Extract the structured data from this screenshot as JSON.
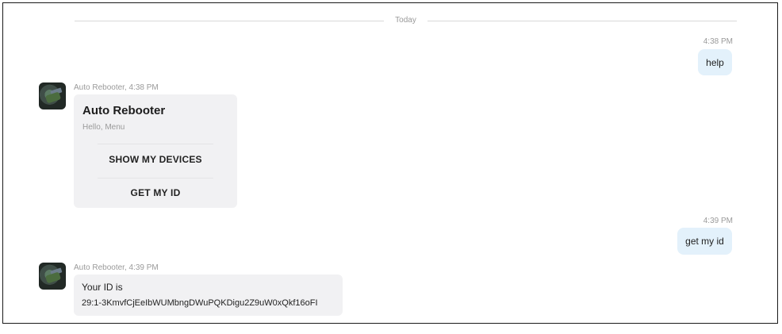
{
  "day_divider": "Today",
  "messages": [
    {
      "direction": "outgoing",
      "time": "4:38 PM",
      "text": "help"
    },
    {
      "direction": "incoming",
      "sender_line": "Auto Rebooter, 4:38 PM",
      "card": {
        "title": "Auto Rebooter",
        "subtitle": "Hello, Menu",
        "buttons": [
          "SHOW MY DEVICES",
          "GET MY ID"
        ]
      }
    },
    {
      "direction": "outgoing",
      "time": "4:39 PM",
      "text": "get my id"
    },
    {
      "direction": "incoming",
      "sender_line": "Auto Rebooter, 4:39 PM",
      "lines": [
        "Your ID is",
        "29:1-3KmvfCjEeIbWUMbngDWuPQKDigu2Z9uW0xQkf16oFI"
      ]
    }
  ]
}
